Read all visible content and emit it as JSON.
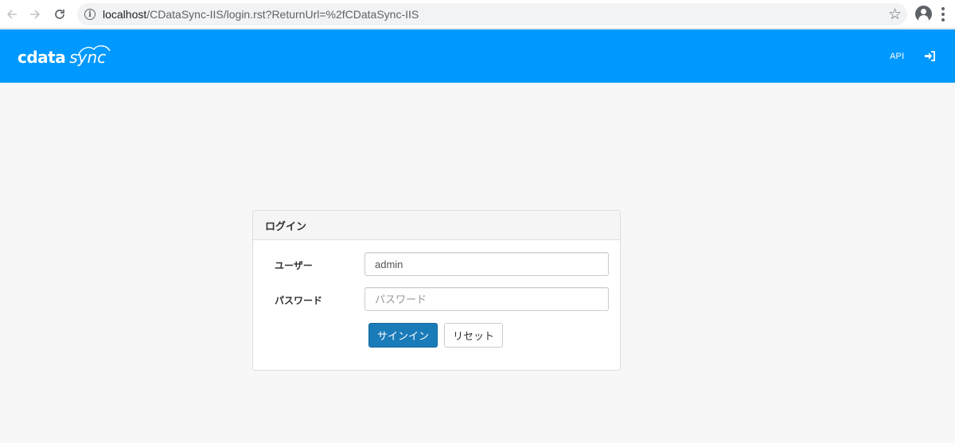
{
  "browser": {
    "url_host": "localhost",
    "url_path": "/CDataSync-IIS/login.rst?ReturnUrl=%2fCDataSync-IIS",
    "back_icon": "arrow-left-icon",
    "forward_icon": "arrow-right-icon",
    "reload_icon": "reload-icon",
    "info_icon": "info-icon",
    "bookmark_icon": "star-icon",
    "profile_icon": "account-circle-icon",
    "menu_icon": "kebab-menu-icon"
  },
  "header": {
    "logo_part1": "cdata",
    "logo_part2": "sync",
    "api_label": "API",
    "signin_icon": "sign-in-icon",
    "background_color": "#0099ff"
  },
  "login": {
    "title": "ログイン",
    "user_label": "ユーザー",
    "user_value": "admin",
    "password_label": "パスワード",
    "password_placeholder": "パスワード",
    "signin_button": "サインイン",
    "reset_button": "リセット",
    "primary_color": "#1a7bb9"
  }
}
